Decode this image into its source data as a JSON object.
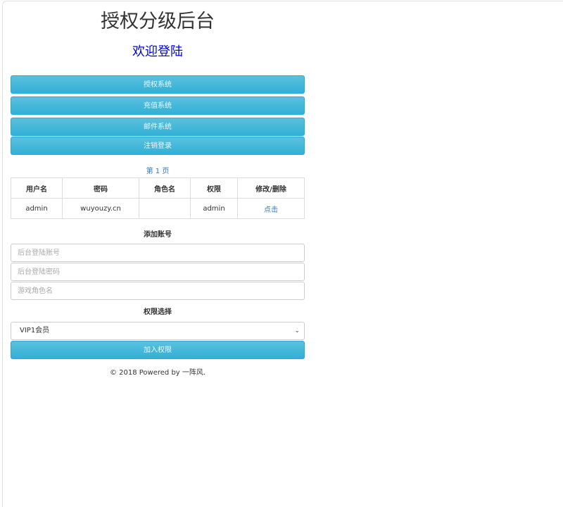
{
  "header": {
    "title": "授权分级后台",
    "welcome": "欢迎登陆"
  },
  "nav": {
    "items": [
      {
        "label": "授权系统"
      },
      {
        "label": "充值系统"
      },
      {
        "label": "邮件系统"
      },
      {
        "label": "注销登录"
      }
    ]
  },
  "pagination": {
    "label": "第 1 页"
  },
  "table": {
    "columns": [
      "用户名",
      "密码",
      "角色名",
      "权限",
      "修改/删除"
    ],
    "rows": [
      {
        "username": "admin",
        "password": "wuyouzy.cn",
        "role": "",
        "permission": "admin",
        "action": "点击"
      }
    ]
  },
  "add_account": {
    "heading": "添加账号",
    "account_placeholder": "后台登陆账号",
    "password_placeholder": "后台登陆密码",
    "role_placeholder": "游戏角色名"
  },
  "permission": {
    "heading": "权限选择",
    "selected": "VIP1会员",
    "submit_label": "加入权限"
  },
  "footer": {
    "text": "© 2018 Powered by 一阵风."
  },
  "colors": {
    "button": "#31b0d5",
    "link": "#337ab7",
    "welcome": "#0000ee"
  }
}
